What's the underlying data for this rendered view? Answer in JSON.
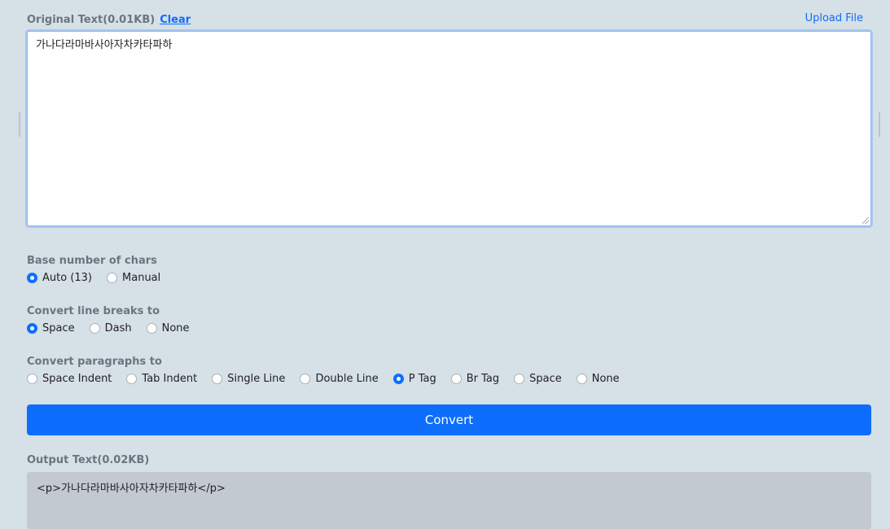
{
  "input": {
    "label": "Original Text(0.01KB)",
    "clear_label": "Clear",
    "upload_label": "Upload File",
    "value": "가나다라마바사아자차카타파하"
  },
  "base_chars": {
    "label": "Base number of chars",
    "options": [
      {
        "label": "Auto (13)",
        "checked": true
      },
      {
        "label": "Manual",
        "checked": false
      }
    ]
  },
  "line_breaks": {
    "label": "Convert line breaks to",
    "options": [
      {
        "label": "Space",
        "checked": true
      },
      {
        "label": "Dash",
        "checked": false
      },
      {
        "label": "None",
        "checked": false
      }
    ]
  },
  "paragraphs": {
    "label": "Convert paragraphs to",
    "options": [
      {
        "label": "Space Indent",
        "checked": false
      },
      {
        "label": "Tab Indent",
        "checked": false
      },
      {
        "label": "Single Line",
        "checked": false
      },
      {
        "label": "Double Line",
        "checked": false
      },
      {
        "label": "P Tag",
        "checked": true
      },
      {
        "label": "Br Tag",
        "checked": false
      },
      {
        "label": "Space",
        "checked": false
      },
      {
        "label": "None",
        "checked": false
      }
    ]
  },
  "convert_label": "Convert",
  "output": {
    "label": "Output Text(0.02KB)",
    "value": "<p>가나다라마바사아자차카타파하</p>"
  },
  "colors": {
    "accent": "#0d6efd",
    "background": "#d6e0e7",
    "output_bg": "#c2c9d0"
  }
}
